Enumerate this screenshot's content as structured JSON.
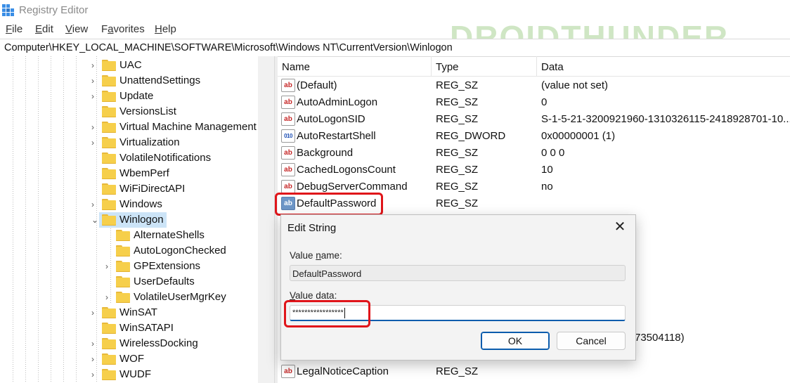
{
  "window": {
    "title": "Registry Editor"
  },
  "menu": [
    {
      "accel": "F",
      "rest": "ile"
    },
    {
      "accel": "E",
      "rest": "dit"
    },
    {
      "accel": "V",
      "rest": "iew"
    },
    {
      "pre": "F",
      "accel": "a",
      "rest": "vorites"
    },
    {
      "accel": "H",
      "rest": "elp"
    }
  ],
  "address": "Computer\\HKEY_LOCAL_MACHINE\\SOFTWARE\\Microsoft\\Windows NT\\CurrentVersion\\Winlogon",
  "watermark": "DROIDTHUNDER",
  "tree": [
    {
      "label": "UAC",
      "depth": 0,
      "expander": "›"
    },
    {
      "label": "UnattendSettings",
      "depth": 0,
      "expander": "›"
    },
    {
      "label": "Update",
      "depth": 0,
      "expander": "›"
    },
    {
      "label": "VersionsList",
      "depth": 0,
      "expander": ""
    },
    {
      "label": "Virtual Machine Management",
      "depth": 0,
      "expander": "›"
    },
    {
      "label": "Virtualization",
      "depth": 0,
      "expander": "›"
    },
    {
      "label": "VolatileNotifications",
      "depth": 0,
      "expander": ""
    },
    {
      "label": "WbemPerf",
      "depth": 0,
      "expander": ""
    },
    {
      "label": "WiFiDirectAPI",
      "depth": 0,
      "expander": ""
    },
    {
      "label": "Windows",
      "depth": 0,
      "expander": "›"
    },
    {
      "label": "Winlogon",
      "depth": 0,
      "expander": "⌄",
      "selected": true
    },
    {
      "label": "AlternateShells",
      "depth": 1,
      "expander": ""
    },
    {
      "label": "AutoLogonChecked",
      "depth": 1,
      "expander": ""
    },
    {
      "label": "GPExtensions",
      "depth": 1,
      "expander": "›"
    },
    {
      "label": "UserDefaults",
      "depth": 1,
      "expander": ""
    },
    {
      "label": "VolatileUserMgrKey",
      "depth": 1,
      "expander": "›"
    },
    {
      "label": "WinSAT",
      "depth": 0,
      "expander": "›"
    },
    {
      "label": "WinSATAPI",
      "depth": 0,
      "expander": ""
    },
    {
      "label": "WirelessDocking",
      "depth": 0,
      "expander": "›"
    },
    {
      "label": "WOF",
      "depth": 0,
      "expander": "›"
    },
    {
      "label": "WUDF",
      "depth": 0,
      "expander": "›"
    }
  ],
  "list": {
    "columns": [
      "Name",
      "Type",
      "Data"
    ],
    "rows": [
      {
        "icon": "string-value-icon",
        "name": "(Default)",
        "type": "REG_SZ",
        "data": "(value not set)"
      },
      {
        "icon": "string-value-icon",
        "name": "AutoAdminLogon",
        "type": "REG_SZ",
        "data": "0"
      },
      {
        "icon": "string-value-icon",
        "name": "AutoLogonSID",
        "type": "REG_SZ",
        "data": "S-1-5-21-3200921960-1310326115-2418928701-10..."
      },
      {
        "icon": "binary-value-icon",
        "name": "AutoRestartShell",
        "type": "REG_DWORD",
        "data": "0x00000001 (1)"
      },
      {
        "icon": "string-value-icon",
        "name": "Background",
        "type": "REG_SZ",
        "data": "0 0 0"
      },
      {
        "icon": "string-value-icon",
        "name": "CachedLogonsCount",
        "type": "REG_SZ",
        "data": "10"
      },
      {
        "icon": "string-value-icon",
        "name": "DebugServerCommand",
        "type": "REG_SZ",
        "data": "no"
      },
      {
        "icon": "string-value-icon",
        "name": "DefaultPassword",
        "type": "REG_SZ",
        "data": "",
        "selected": true
      }
    ],
    "partial_data": "73504118)",
    "bottom_row": {
      "icon": "string-value-icon",
      "name": "LegalNoticeCaption",
      "type": "REG_SZ"
    }
  },
  "dialog": {
    "title": "Edit String",
    "close_glyph": "✕",
    "value_name_label": {
      "pre": "Value ",
      "accel": "n",
      "rest": "ame:"
    },
    "value_name": "DefaultPassword",
    "value_data_label": {
      "pre": "",
      "accel": "V",
      "rest": "alue data:"
    },
    "value_data": "*****************",
    "ok": "OK",
    "cancel": "Cancel"
  },
  "colors": {
    "highlight": "#e0151a",
    "selection": "#cce4f7",
    "folder": "#f6cf4b",
    "watermark": "#cfe6c4"
  }
}
